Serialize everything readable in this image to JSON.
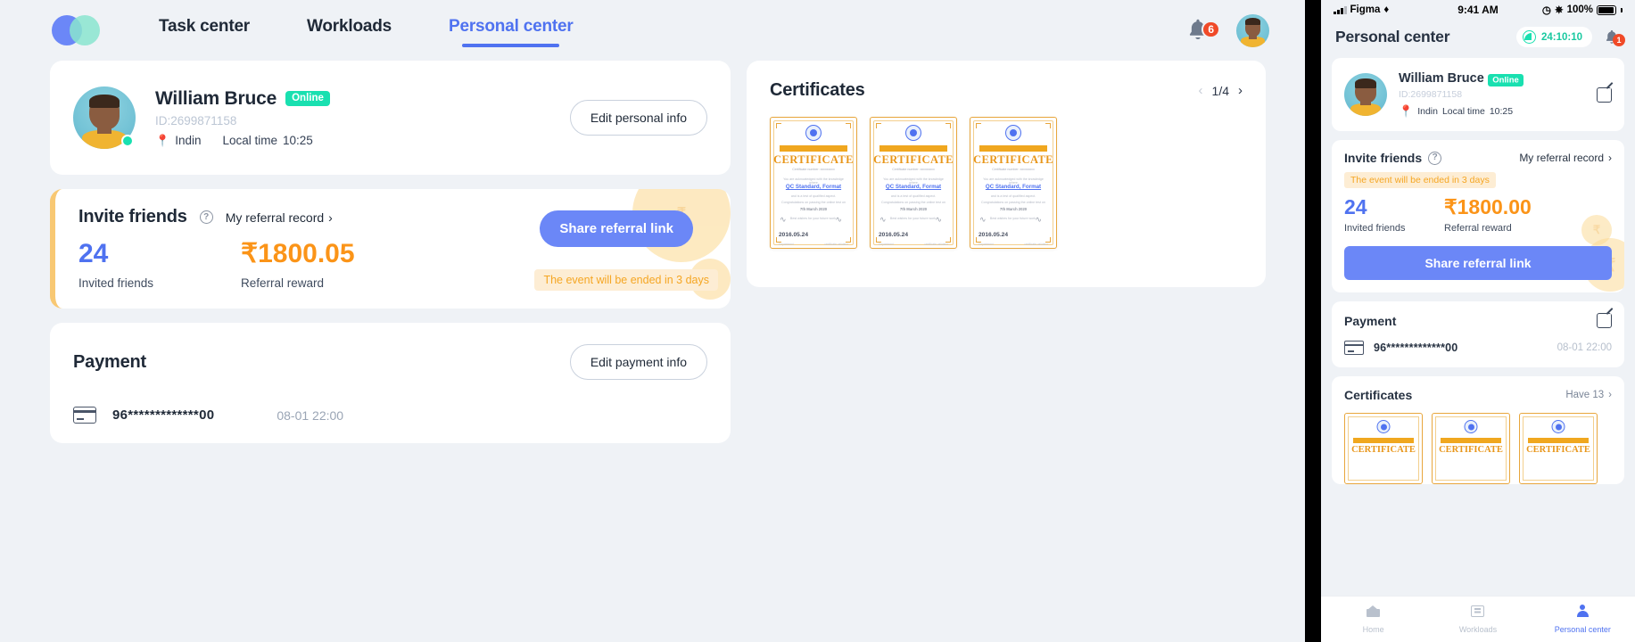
{
  "header": {
    "nav": [
      {
        "label": "Task center",
        "active": false
      },
      {
        "label": "Workloads",
        "active": false
      },
      {
        "label": "Personal center",
        "active": true
      }
    ],
    "notification_count": "6",
    "accent_color": "#4f72f0"
  },
  "profile": {
    "name": "William Bruce",
    "status": "Online",
    "id": "ID:2699871158",
    "location": "Indin",
    "local_time_label": "Local time",
    "local_time": "10:25",
    "edit_button": "Edit personal info"
  },
  "invite": {
    "title": "Invite friends",
    "referral_record": "My referral record",
    "invited_count": "24",
    "invited_label": "Invited friends",
    "reward_amount": "₹1800.05",
    "reward_label": "Referral reward",
    "share_button": "Share referral link",
    "event_tip": "The event will be ended in 3 days",
    "count_color": "#4f72f0",
    "reward_color": "#fb9418"
  },
  "payment": {
    "title": "Payment",
    "edit_button": "Edit payment info",
    "card_number": "96*************00",
    "date": "08-01 22:00"
  },
  "certificates": {
    "title": "Certificates",
    "page": "1/4",
    "items": [
      {
        "qualification": "QUALIFICATION",
        "word": "CERTIFICATE",
        "number": "Certificate number: xxxxxxxxx",
        "line1": "You are acknowledged with the knowledge where",
        "program": "QC Standard, Format",
        "line2": "and is a test of qualified aspect.",
        "line3": "Congratulations on passing the online test on",
        "date_text": "7th March 2020",
        "line4": "Best wishes for your future work.",
        "date": "2016.05.24",
        "footer_left": "Department",
        "footer_right": "certificate-validator"
      },
      {
        "qualification": "QUALIFICATION",
        "word": "CERTIFICATE",
        "number": "Certificate number: xxxxxxxxx",
        "line1": "You are acknowledged with the knowledge where",
        "program": "QC Standard, Format",
        "line2": "and is a test of qualified aspect.",
        "line3": "Congratulations on passing the online test on",
        "date_text": "7th March 2020",
        "line4": "Best wishes for your future work.",
        "date": "2016.05.24",
        "footer_left": "Department",
        "footer_right": "certificate-validator"
      },
      {
        "qualification": "QUALIFICATION",
        "word": "CERTIFICATE",
        "number": "Certificate number: xxxxxxxxx",
        "line1": "You are acknowledged with the knowledge where",
        "program": "QC Standard, Format",
        "line2": "and is a test of qualified aspect.",
        "line3": "Congratulations on passing the online test on",
        "date_text": "7th March 2020",
        "line4": "Best wishes for your future work.",
        "date": "2016.05.24",
        "footer_left": "Department",
        "footer_right": "certificate-validator"
      }
    ]
  },
  "phone": {
    "statusbar": {
      "carrier": "Figma",
      "time": "9:41 AM",
      "battery": "100%"
    },
    "title": "Personal center",
    "timer": "24:10:10",
    "notification_count": "1",
    "profile": {
      "name": "William Bruce",
      "status": "Online",
      "id": "ID:2699871158",
      "location": "Indin",
      "local_time_label": "Local time",
      "local_time": "10:25"
    },
    "invite": {
      "title": "Invite friends",
      "referral_record": "My referral record",
      "event_tip": "The event will be ended in 3 days",
      "invited_count": "24",
      "invited_label": "Invited friends",
      "reward_amount": "₹1800.00",
      "reward_label": "Referral reward",
      "share_button": "Share referral link"
    },
    "payment": {
      "title": "Payment",
      "card_number": "96*************00",
      "date": "08-01 22:00"
    },
    "certificates": {
      "title": "Certificates",
      "have_label": "Have 13",
      "items": [
        {
          "word": "CERTIFICATE"
        },
        {
          "word": "CERTIFICATE"
        },
        {
          "word": "CERTIFICATE"
        }
      ]
    },
    "tabs": [
      {
        "label": "Home",
        "active": false
      },
      {
        "label": "Workloads",
        "active": false
      },
      {
        "label": "Personal center",
        "active": true
      }
    ]
  }
}
